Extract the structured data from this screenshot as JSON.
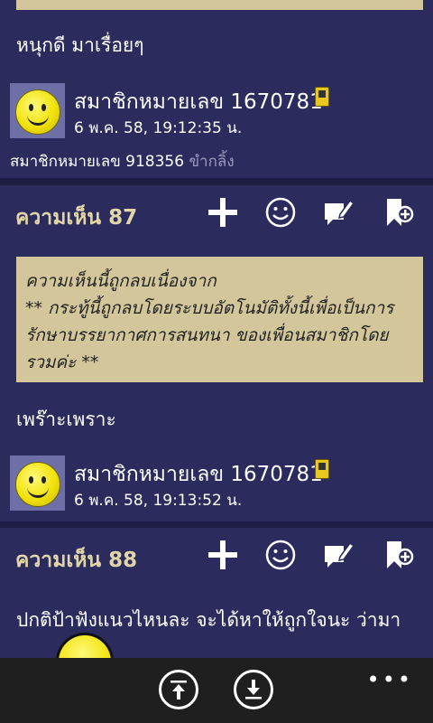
{
  "post1": {
    "body": "หนุกดี มาเรื่อยๆ",
    "author": "สมาชิกหมายเลข 1670781",
    "timestamp": "6 พ.ค. 58, 19:12:35 น.",
    "thanked_by": "สมาชิกหมายเลข 918356",
    "thanked_label": "ขำกลิ้ง"
  },
  "comment87": {
    "title": "ความเห็น 87",
    "deleted_notice": "ความเห็นนี้ถูกลบเนื่องจาก\n** กระทู้นี้ถูกลบโดยระบบอัตโนมัติทั้งนี้เพื่อเป็นการรักษาบรรยากาศการสนทนา ของเพื่อนสมาชิกโดยรวมค่ะ **",
    "body": "เพร๊าะเพราะ",
    "author": "สมาชิกหมายเลข 1670781",
    "timestamp": "6 พ.ค. 58, 19:13:52 น."
  },
  "comment88": {
    "title": "ความเห็น 88",
    "body": "ปกติป้าฟังแนวไหนละ จะได้หาให้ถูกใจนะ ว่ามา"
  },
  "actions": [
    "plus-icon",
    "smiley-icon",
    "reply-edit-icon",
    "bookmark-add-icon"
  ],
  "appbar": {
    "more": "•••",
    "buttons": [
      "scroll-top-icon",
      "scroll-bottom-icon"
    ]
  },
  "colors": {
    "background": "#1d1d44",
    "card": "#2b2b5d",
    "quote": "#d3c69a",
    "title": "#e2d6a8",
    "appbar": "#1f1f1f"
  }
}
